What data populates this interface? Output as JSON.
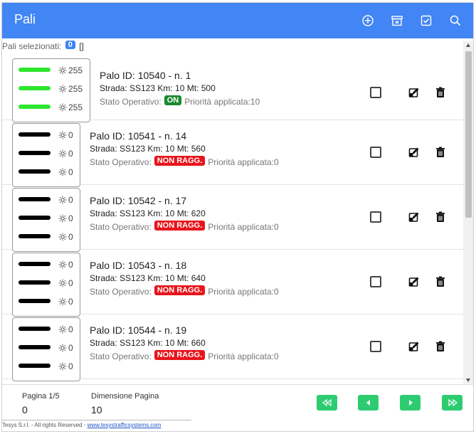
{
  "header": {
    "title": "Pali",
    "icons": [
      "add-circle-icon",
      "archive-icon",
      "checkbox-checked-icon",
      "search-icon"
    ]
  },
  "selection": {
    "label": "Pali selezionati:",
    "count": "0",
    "list": "[]"
  },
  "rows": [
    {
      "pid": "Palo ID: 10540 - n. 1",
      "road": "Strada: SS123 Km: 10 Mt: 500",
      "status_label": "Stato Operativo:",
      "status": "ON",
      "status_color": "#1a8a2e",
      "priority": "Priorità applicata:10",
      "lamps": [
        {
          "value": "255",
          "color": "#2ee62e"
        },
        {
          "value": "255",
          "color": "#2ee62e"
        },
        {
          "value": "255",
          "color": "#2ee62e"
        }
      ]
    },
    {
      "pid": "Palo ID: 10541 - n. 14",
      "road": "Strada: SS123 Km: 10 Mt: 560",
      "status_label": "Stato Operativo:",
      "status": "NON RAGG.",
      "status_color": "#e8141c",
      "priority": "Priorità applicata:0",
      "lamps": [
        {
          "value": "0",
          "color": "#000000"
        },
        {
          "value": "0",
          "color": "#000000"
        },
        {
          "value": "0",
          "color": "#000000"
        }
      ]
    },
    {
      "pid": "Palo ID: 10542 - n. 17",
      "road": "Strada: SS123 Km: 10 Mt: 620",
      "status_label": "Stato Operativo:",
      "status": "NON RAGG.",
      "status_color": "#e8141c",
      "priority": "Priorità applicata:0",
      "lamps": [
        {
          "value": "0",
          "color": "#000000"
        },
        {
          "value": "0",
          "color": "#000000"
        },
        {
          "value": "0",
          "color": "#000000"
        }
      ]
    },
    {
      "pid": "Palo ID: 10543 - n. 18",
      "road": "Strada: SS123 Km: 10 Mt: 640",
      "status_label": "Stato Operativo:",
      "status": "NON RAGG.",
      "status_color": "#e8141c",
      "priority": "Priorità applicata:0",
      "lamps": [
        {
          "value": "0",
          "color": "#000000"
        },
        {
          "value": "0",
          "color": "#000000"
        },
        {
          "value": "0",
          "color": "#000000"
        }
      ]
    },
    {
      "pid": "Palo ID: 10544 - n. 19",
      "road": "Strada: SS123 Km: 10 Mt: 660",
      "status_label": "Stato Operativo:",
      "status": "NON RAGG.",
      "status_color": "#e8141c",
      "priority": "Priorità applicata:0",
      "lamps": [
        {
          "value": "0",
          "color": "#000000"
        },
        {
          "value": "0",
          "color": "#000000"
        },
        {
          "value": "0",
          "color": "#000000"
        }
      ]
    }
  ],
  "footer": {
    "page_label": "Pagina 1/5",
    "page_value": "0",
    "size_label": "Dimensione Pagina",
    "size_value": "10",
    "buttons": [
      "first-page-icon",
      "prev-page-icon",
      "next-page-icon",
      "last-page-icon"
    ]
  },
  "copyright": {
    "text": "Tesys S.r.l. - All rights Reserved - ",
    "link": "www.tesystrafficsystems.com"
  },
  "colors": {
    "header": "#4285f4",
    "page_button": "#2ecc71",
    "badge": "#3b82f6"
  }
}
